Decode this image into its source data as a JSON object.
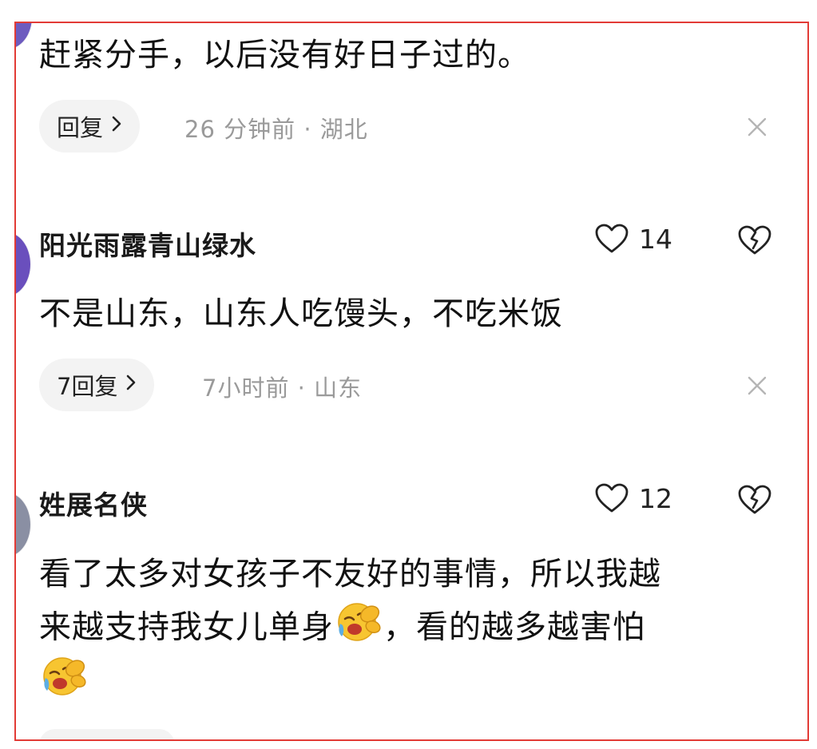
{
  "comments": [
    {
      "text": "赶紧分手，以后没有好日子过的。",
      "reply_label": "回复",
      "meta": "26 分钟前 · 湖北"
    },
    {
      "username": "阳光雨露青山绿水",
      "likes": "14",
      "text": "不是山东，山东人吃馒头，不吃米饭",
      "reply_label": "7回复",
      "meta": "7小时前 · 山东"
    },
    {
      "username": "姓展名侠",
      "likes": "12",
      "text_line1": "看了太多对女孩子不友好的事情，所以我越",
      "text_line2_a": "来越支持我女儿单身",
      "text_line2_b": "，看的越多越害怕"
    }
  ],
  "icons": {
    "heart": "heart-icon",
    "broken_heart": "broken-heart-icon",
    "close": "close-icon",
    "chevron": "chevron-right-icon",
    "emoji": "laughing-crying-emoji"
  },
  "colors": {
    "frame_border": "#e23b36",
    "meta_text": "#9a9a9a",
    "pill_bg": "#f3f3f3"
  }
}
